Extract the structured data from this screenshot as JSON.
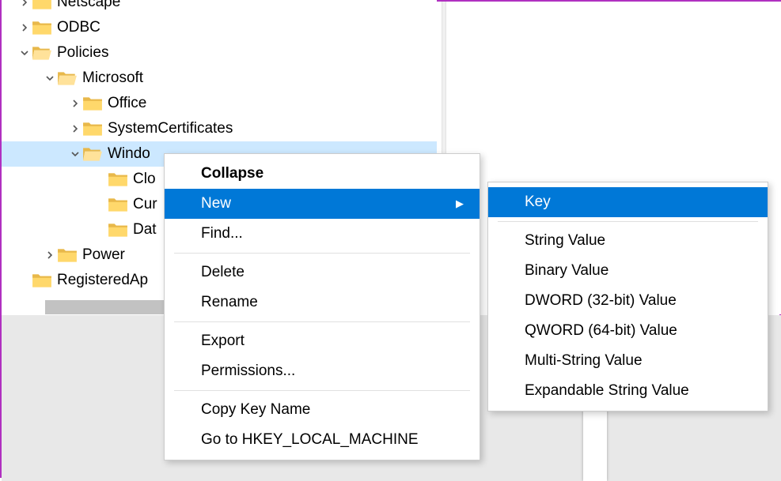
{
  "tree": {
    "items": [
      {
        "indent": 0,
        "chevron": "right",
        "label": "Netscape",
        "open": false
      },
      {
        "indent": 0,
        "chevron": "right",
        "label": "ODBC",
        "open": false
      },
      {
        "indent": 0,
        "chevron": "down",
        "label": "Policies",
        "open": true
      },
      {
        "indent": 1,
        "chevron": "down",
        "label": "Microsoft",
        "open": true
      },
      {
        "indent": 2,
        "chevron": "right",
        "label": "Office",
        "open": false
      },
      {
        "indent": 2,
        "chevron": "right",
        "label": "SystemCertificates",
        "open": false
      },
      {
        "indent": 2,
        "chevron": "down",
        "label": "Windo",
        "open": true,
        "selected": true
      },
      {
        "indent": 3,
        "chevron": "none",
        "label": "Clo",
        "open": false
      },
      {
        "indent": 3,
        "chevron": "none",
        "label": "Cur",
        "open": false
      },
      {
        "indent": 3,
        "chevron": "none",
        "label": "Dat",
        "open": false
      },
      {
        "indent": 1,
        "chevron": "right",
        "label": "Power",
        "open": false
      },
      {
        "indent": 0,
        "chevron": "none",
        "label": "RegisteredAp",
        "open": false
      }
    ]
  },
  "contextMenu": {
    "collapse": "Collapse",
    "new": "New",
    "find": "Find...",
    "delete": "Delete",
    "rename": "Rename",
    "export": "Export",
    "permissions": "Permissions...",
    "copyKeyName": "Copy Key Name",
    "goTo": "Go to HKEY_LOCAL_MACHINE"
  },
  "newSubmenu": {
    "key": "Key",
    "stringValue": "String Value",
    "binaryValue": "Binary Value",
    "dword": "DWORD (32-bit) Value",
    "qword": "QWORD (64-bit) Value",
    "multiString": "Multi-String Value",
    "expandable": "Expandable String Value"
  }
}
